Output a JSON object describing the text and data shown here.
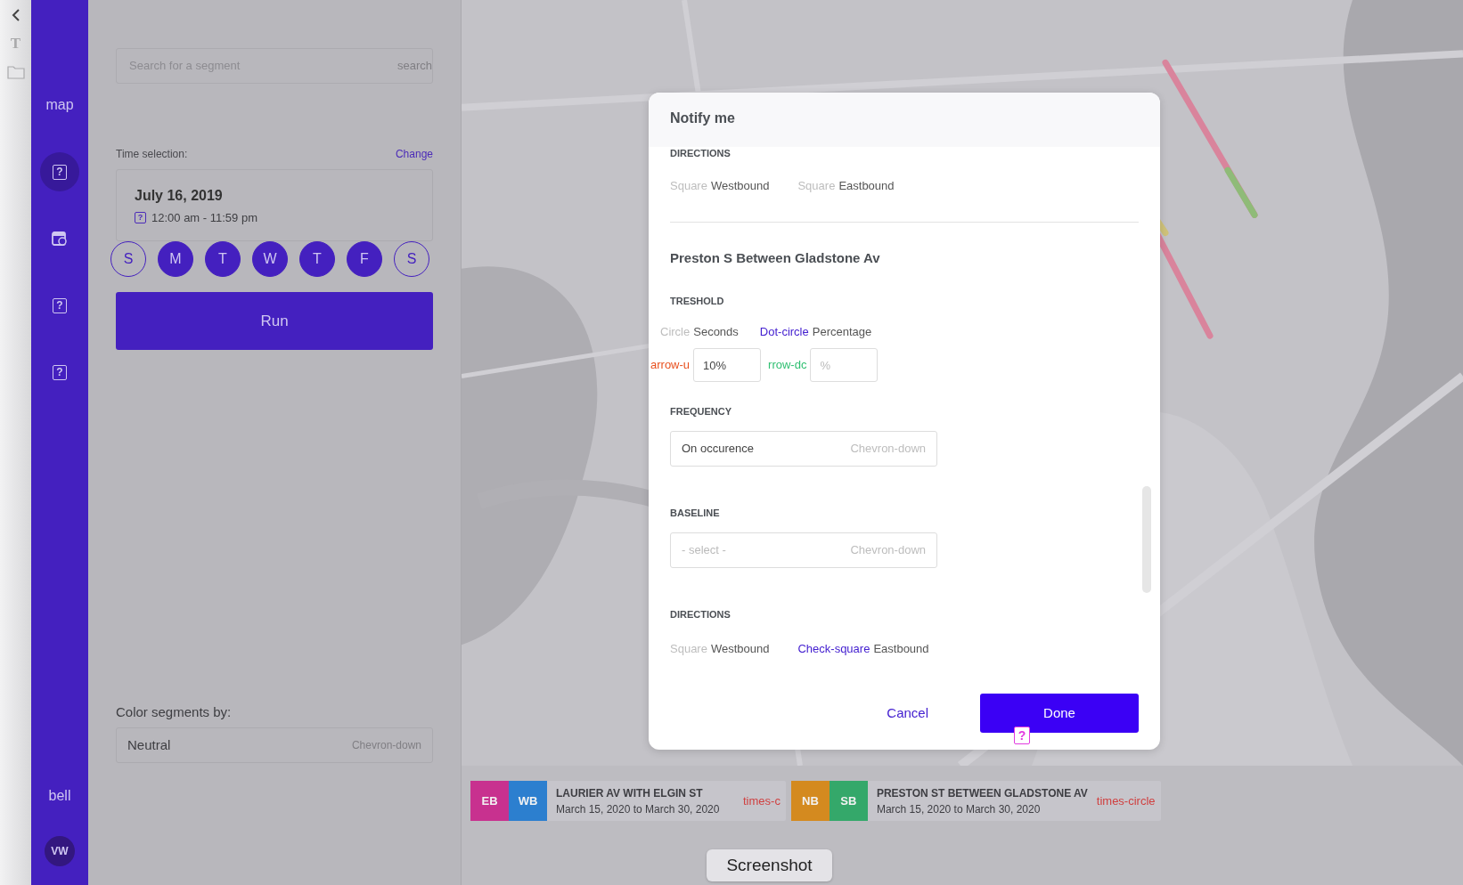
{
  "edge_strip": {
    "glyph": "T"
  },
  "sidebar": {
    "items": [
      {
        "kind": "text",
        "label": "map",
        "selected": false
      },
      {
        "kind": "help",
        "glyph": "?",
        "selected": true
      },
      {
        "kind": "calendar",
        "selected": false
      },
      {
        "kind": "help",
        "glyph": "?",
        "selected": false
      },
      {
        "kind": "help",
        "glyph": "?",
        "selected": false
      }
    ],
    "bell_label": "bell",
    "avatar": "VW"
  },
  "panel": {
    "search": {
      "placeholder": "Search for a segment",
      "icon_text": "search"
    },
    "time_selection": {
      "label": "Time selection:",
      "change": "Change",
      "date": "July 16, 2019",
      "glyph": "?",
      "time": "12:00 am - 11:59 pm"
    },
    "days": [
      {
        "label": "S",
        "selected": false
      },
      {
        "label": "M",
        "selected": true
      },
      {
        "label": "T",
        "selected": true
      },
      {
        "label": "W",
        "selected": true
      },
      {
        "label": "T",
        "selected": true
      },
      {
        "label": "F",
        "selected": true
      },
      {
        "label": "S",
        "selected": false
      }
    ],
    "run": "Run",
    "color_by": {
      "label": "Color segments by:",
      "value": "Neutral",
      "icon_text": "Chevron-down"
    }
  },
  "modal": {
    "title": "Notify me",
    "top_directions": {
      "label": "DIRECTIONS",
      "options": [
        {
          "icon_text": "Square",
          "label": "Westbound",
          "checked": false
        },
        {
          "icon_text": "Square",
          "label": "Eastbound",
          "checked": false
        }
      ]
    },
    "segment_title": "Preston S Between Gladstone Av",
    "threshold": {
      "label": "TRESHOLD",
      "options": [
        {
          "icon_text": "Circle",
          "label": "Seconds",
          "selected": false
        },
        {
          "icon_text": "Dot-circle",
          "label": "Percentage",
          "selected": true
        }
      ],
      "inputs": [
        {
          "icon_text": "arrow-u",
          "value": "10%",
          "color": "#e8501e"
        },
        {
          "icon_text": "rrow-dc",
          "placeholder": "%",
          "color": "#2fbf71"
        }
      ]
    },
    "frequency": {
      "label": "FREQUENCY",
      "value": "On occurence",
      "icon_text": "Chevron-down"
    },
    "baseline": {
      "label": "BASELINE",
      "placeholder": "- select -",
      "icon_text": "Chevron-down"
    },
    "directions": {
      "label": "DIRECTIONS",
      "options": [
        {
          "icon_text": "Square",
          "label": "Westbound",
          "checked": false
        },
        {
          "icon_text": "Check-square",
          "label": "Eastbound",
          "checked": true
        }
      ]
    },
    "cancel": "Cancel",
    "done": "Done",
    "done_glyph": "?"
  },
  "segments": [
    {
      "badges": [
        {
          "label": "EB",
          "color": "#c8318f"
        },
        {
          "label": "WB",
          "color": "#2c7fcf"
        }
      ],
      "title": "LAURIER AV WITH ELGIN ST",
      "dates": "March 15, 2020 to March 30, 2020",
      "remove_text": "times-c"
    },
    {
      "badges": [
        {
          "label": "NB",
          "color": "#d48a1f"
        },
        {
          "label": "SB",
          "color": "#34a86a"
        }
      ],
      "title": "PRESTON ST BETWEEN GLADSTONE AV",
      "dates": "March 15, 2020 to March 30, 2020",
      "remove_text": "times-circle"
    }
  ],
  "tooltip": "Screenshot"
}
